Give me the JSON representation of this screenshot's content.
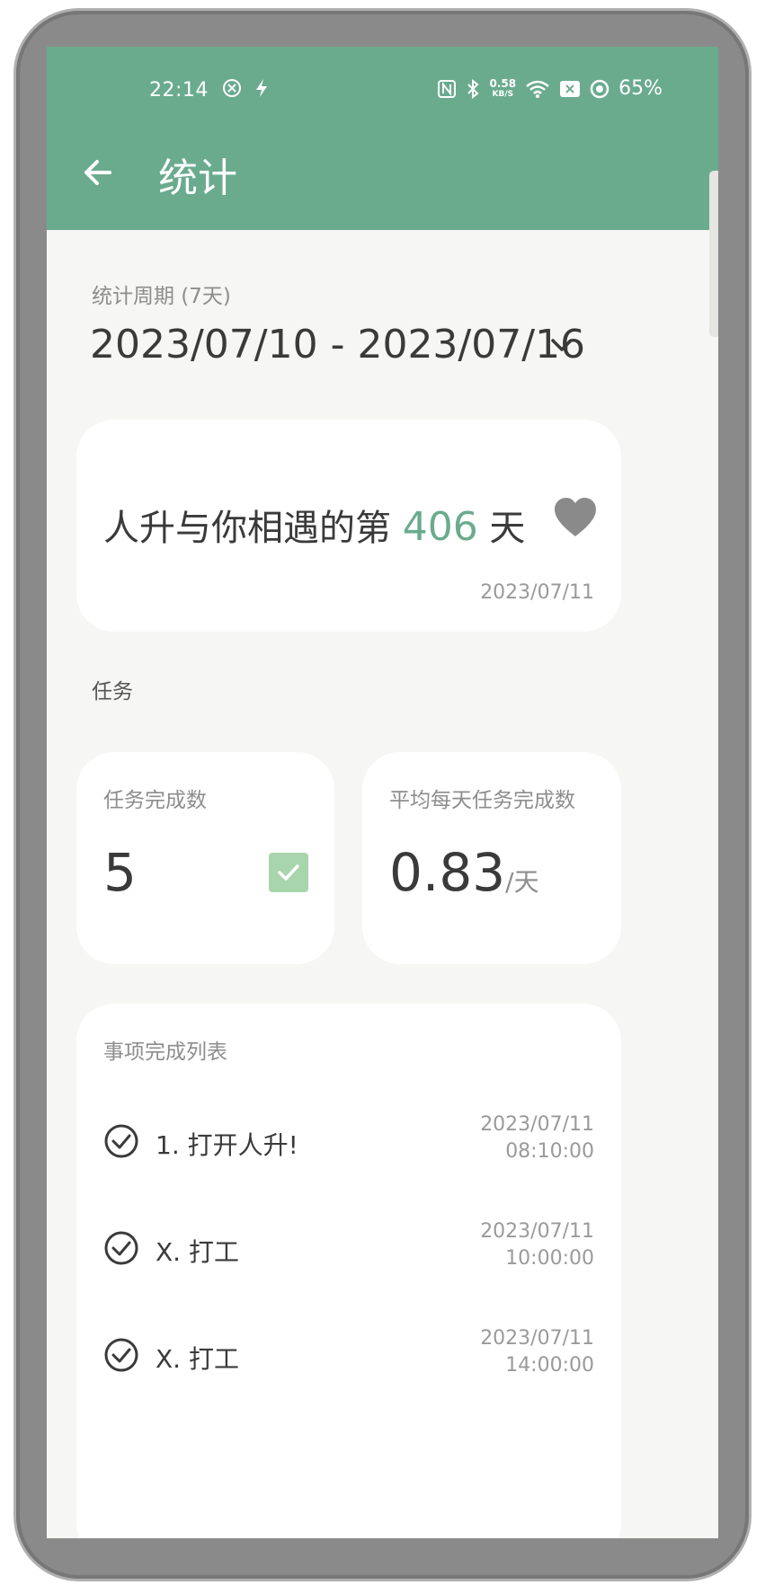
{
  "status_bar": {
    "time": "22:14",
    "net_speed_value": "0.58",
    "net_speed_unit": "KB/S",
    "battery": "65%"
  },
  "app_bar": {
    "title": "统计"
  },
  "period": {
    "label": "统计周期 (7天)",
    "range": "2023/07/10 - 2023/07/16"
  },
  "love_card": {
    "prefix": "人升与你相遇的第 ",
    "days": "406",
    "suffix": " 天",
    "date": "2023/07/11"
  },
  "tasks_section": {
    "title": "任务"
  },
  "stats": {
    "completed_label": "任务完成数",
    "completed_value": "5",
    "avg_label": "平均每天任务完成数",
    "avg_value": "0.83",
    "avg_unit": "/天"
  },
  "completion_list": {
    "title": "事项完成列表",
    "items": [
      {
        "name": "1. 打开人升!",
        "date": "2023/07/11",
        "time": "08:10:00"
      },
      {
        "name": "X. 打工",
        "date": "2023/07/11",
        "time": "10:00:00"
      },
      {
        "name": "X. 打工",
        "date": "2023/07/11",
        "time": "14:00:00"
      }
    ]
  },
  "colors": {
    "accent": "#6aab8e",
    "check_bg": "#a8d5ab",
    "background": "#f6f6f4"
  }
}
